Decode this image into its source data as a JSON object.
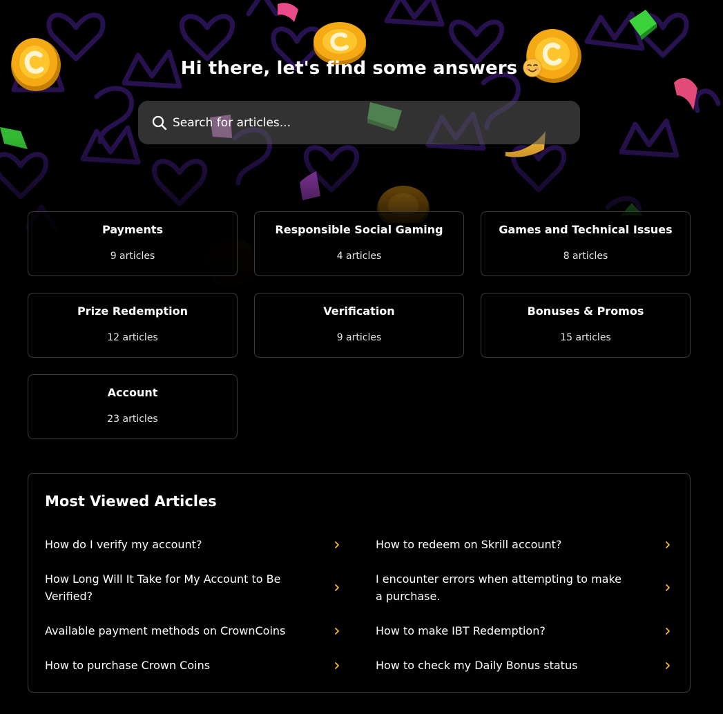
{
  "hero": {
    "title": "Hi there, let's find some answers",
    "emoji_icon": "smiling-face-emoji-icon"
  },
  "search": {
    "placeholder": "Search for articles..."
  },
  "colors": {
    "background": "#000000",
    "pattern": "#3a1a6e",
    "accent_chevron": "#f5b82e",
    "card_border": "#3c3c3c"
  },
  "categories": [
    {
      "title": "Payments",
      "count": "9 articles"
    },
    {
      "title": "Responsible Social Gaming",
      "count": "4 articles"
    },
    {
      "title": "Games and Technical Issues",
      "count": "8 articles"
    },
    {
      "title": "Prize Redemption",
      "count": "12 articles"
    },
    {
      "title": "Verification",
      "count": "9 articles"
    },
    {
      "title": "Bonuses & Promos",
      "count": "15 articles"
    },
    {
      "title": "Account",
      "count": "23 articles"
    }
  ],
  "most_viewed": {
    "title": "Most Viewed Articles",
    "articles": [
      "How do I verify my account?",
      "How to redeem on Skrill account?",
      "How Long Will It Take for My Account to Be Verified?",
      "I encounter errors when attempting to make a purchase.",
      "Available payment methods on CrownCoins",
      "How to make IBT Redemption?",
      "How to purchase Crown Coins",
      "How to check my Daily Bonus status"
    ]
  }
}
